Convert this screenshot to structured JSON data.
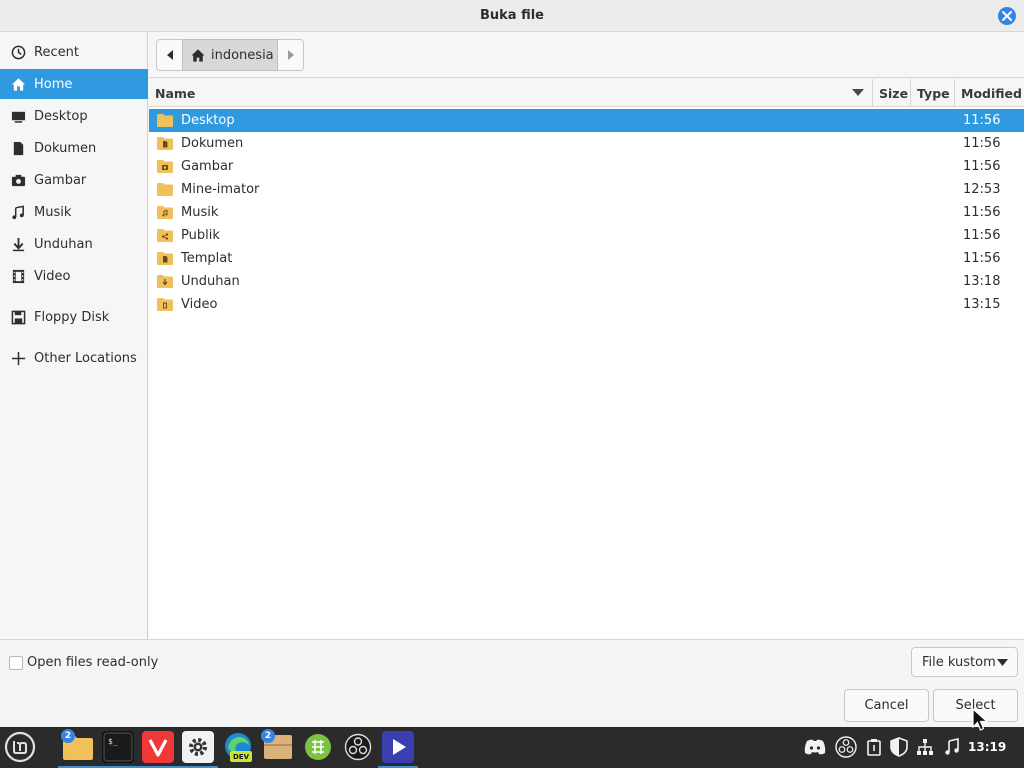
{
  "window": {
    "title": "Buka file"
  },
  "sidebar": {
    "items": [
      {
        "label": "Recent",
        "icon": "clock-icon"
      },
      {
        "label": "Home",
        "icon": "home-icon"
      },
      {
        "label": "Desktop",
        "icon": "desktop-icon"
      },
      {
        "label": "Dokumen",
        "icon": "document-icon"
      },
      {
        "label": "Gambar",
        "icon": "camera-icon"
      },
      {
        "label": "Musik",
        "icon": "music-icon"
      },
      {
        "label": "Unduhan",
        "icon": "download-icon"
      },
      {
        "label": "Video",
        "icon": "film-icon"
      },
      {
        "label": "Floppy Disk",
        "icon": "floppy-icon"
      },
      {
        "label": "Other Locations",
        "icon": "plus-icon"
      }
    ]
  },
  "pathbar": {
    "crumb": "indonesia"
  },
  "columns": {
    "name": "Name",
    "size": "Size",
    "type": "Type",
    "modified": "Modified"
  },
  "files": [
    {
      "name": "Desktop",
      "modified": "11:56"
    },
    {
      "name": "Dokumen",
      "modified": "11:56"
    },
    {
      "name": "Gambar",
      "modified": "11:56"
    },
    {
      "name": "Mine-imator",
      "modified": "12:53"
    },
    {
      "name": "Musik",
      "modified": "11:56"
    },
    {
      "name": "Publik",
      "modified": "11:56"
    },
    {
      "name": "Templat",
      "modified": "11:56"
    },
    {
      "name": "Unduhan",
      "modified": "13:18"
    },
    {
      "name": "Video",
      "modified": "13:15"
    }
  ],
  "bottom": {
    "readonly_label": "Open files read-only",
    "filter_label": "File kustom",
    "cancel_label": "Cancel",
    "select_label": "Select"
  },
  "taskbar": {
    "clock": "13:19",
    "files_badge": "2",
    "archive_badge": "2",
    "dev_label": "DEV"
  },
  "colors": {
    "accent": "#2f9ae0",
    "folder": "#f0c15a",
    "taskbar": "#2b2b2b"
  }
}
